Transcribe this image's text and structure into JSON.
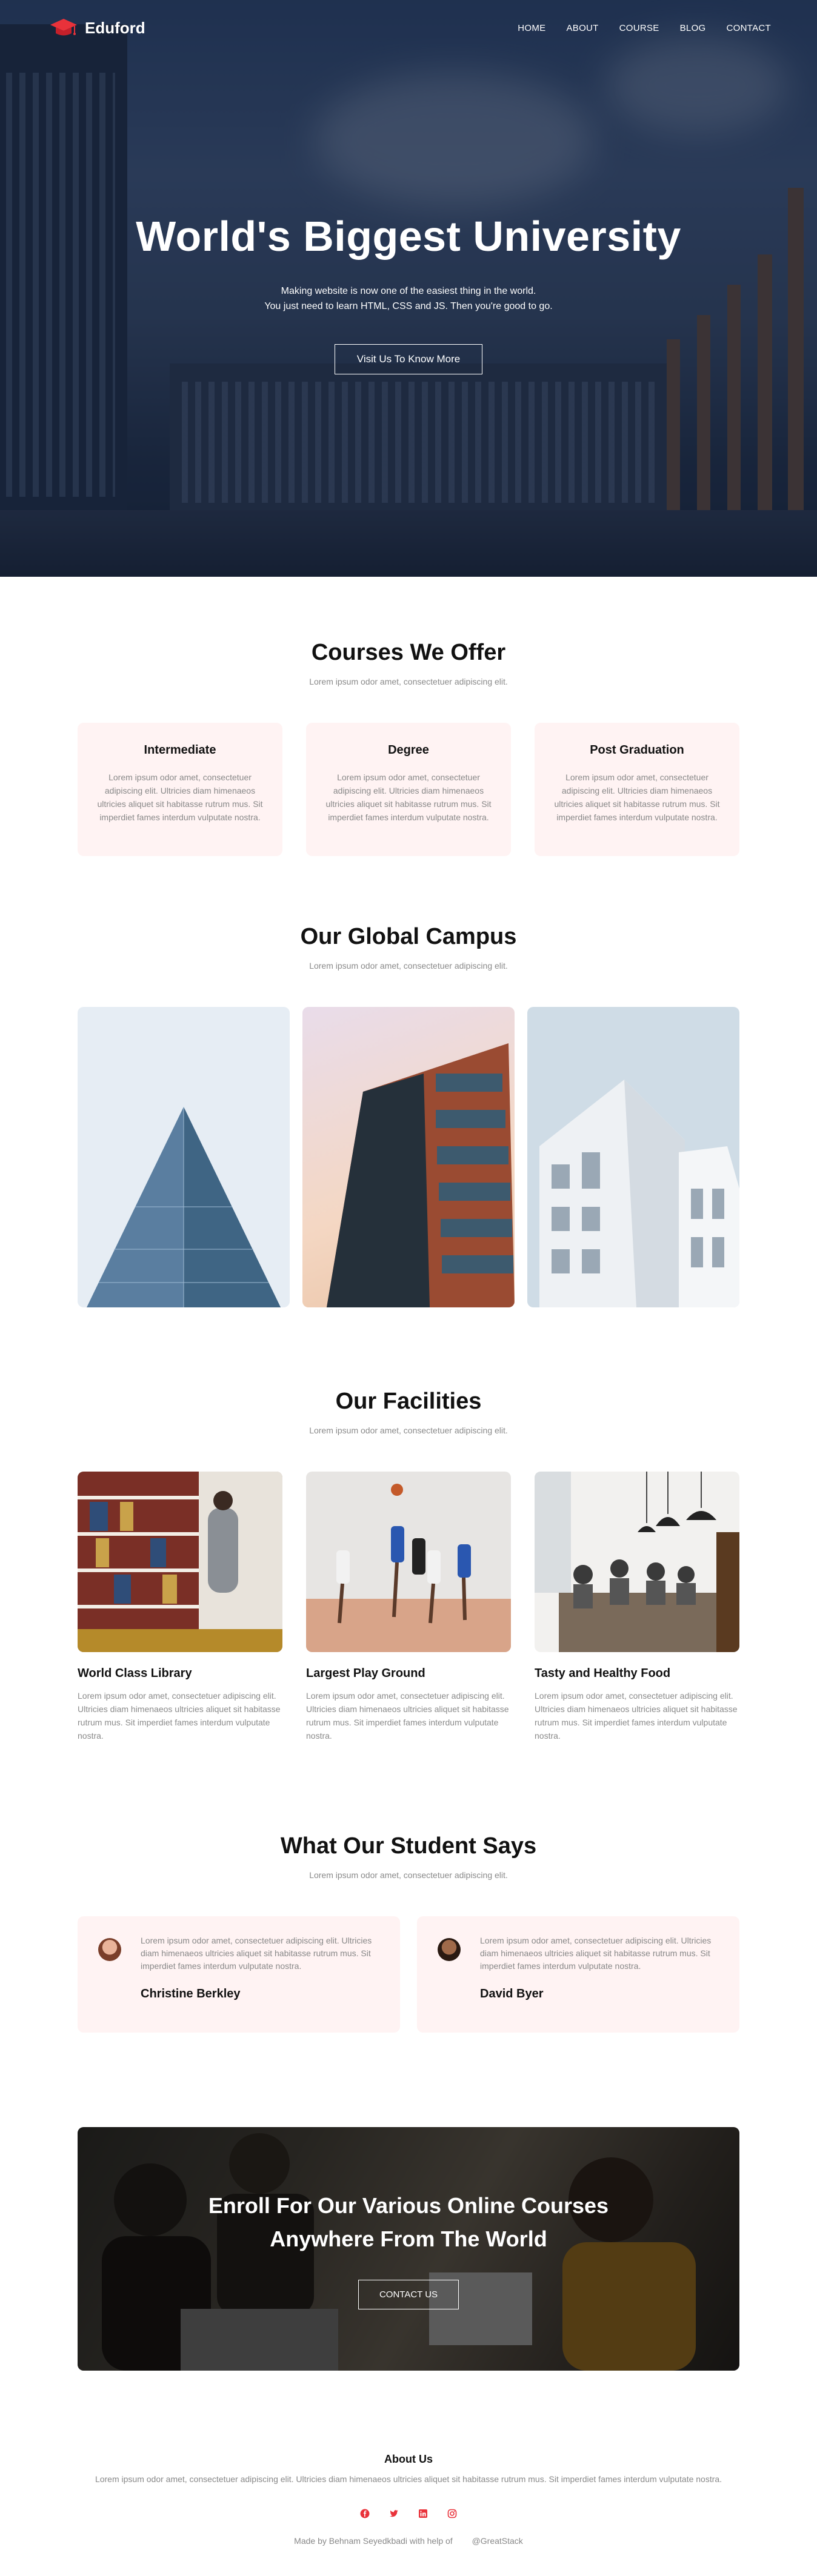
{
  "brand": {
    "name": "Eduford",
    "accent": "#e9323a"
  },
  "nav": {
    "links": [
      "HOME",
      "ABOUT",
      "COURSE",
      "BLOG",
      "CONTACT"
    ]
  },
  "hero": {
    "title": "World's Biggest University",
    "subtitle_line1": "Making website is now one of the easiest thing in the world.",
    "subtitle_line2": "You just need to learn HTML, CSS and JS. Then you're good to go.",
    "button": "Visit Us To Know More"
  },
  "courses": {
    "title": "Courses We Offer",
    "subtitle": "Lorem ipsum odor amet, consectetuer adipiscing elit.",
    "items": [
      {
        "title": "Intermediate",
        "text": "Lorem ipsum odor amet, consectetuer adipiscing elit. Ultricies diam himenaeos ultricies aliquet sit habitasse rutrum mus. Sit imperdiet fames interdum vulputate nostra."
      },
      {
        "title": "Degree",
        "text": "Lorem ipsum odor amet, consectetuer adipiscing elit. Ultricies diam himenaeos ultricies aliquet sit habitasse rutrum mus. Sit imperdiet fames interdum vulputate nostra."
      },
      {
        "title": "Post Graduation",
        "text": "Lorem ipsum odor amet, consectetuer adipiscing elit. Ultricies diam himenaeos ultricies aliquet sit habitasse rutrum mus. Sit imperdiet fames interdum vulputate nostra."
      }
    ]
  },
  "campus": {
    "title": "Our Global Campus",
    "subtitle": "Lorem ipsum odor amet, consectetuer adipiscing elit."
  },
  "facilities": {
    "title": "Our Facilities",
    "subtitle": "Lorem ipsum odor amet, consectetuer adipiscing elit.",
    "items": [
      {
        "title": "World Class Library",
        "text": "Lorem ipsum odor amet, consectetuer adipiscing elit. Ultricies diam himenaeos ultricies aliquet sit habitasse rutrum mus. Sit imperdiet fames interdum vulputate nostra."
      },
      {
        "title": "Largest Play Ground",
        "text": "Lorem ipsum odor amet, consectetuer adipiscing elit. Ultricies diam himenaeos ultricies aliquet sit habitasse rutrum mus. Sit imperdiet fames interdum vulputate nostra."
      },
      {
        "title": "Tasty and Healthy Food",
        "text": "Lorem ipsum odor amet, consectetuer adipiscing elit. Ultricies diam himenaeos ultricies aliquet sit habitasse rutrum mus. Sit imperdiet fames interdum vulputate nostra."
      }
    ]
  },
  "testimonials": {
    "title": "What Our Student Says",
    "subtitle": "Lorem ipsum odor amet, consectetuer adipiscing elit.",
    "items": [
      {
        "name": "Christine Berkley",
        "text": "Lorem ipsum odor amet, consectetuer adipiscing elit. Ultricies diam himenaeos ultricies aliquet sit habitasse rutrum mus. Sit imperdiet fames interdum vulputate nostra."
      },
      {
        "name": "David Byer",
        "text": "Lorem ipsum odor amet, consectetuer adipiscing elit. Ultricies diam himenaeos ultricies aliquet sit habitasse rutrum mus. Sit imperdiet fames interdum vulputate nostra."
      }
    ]
  },
  "cta": {
    "title_line1": "Enroll For Our Various Online Courses",
    "title_line2": "Anywhere From The World",
    "button": "CONTACT US"
  },
  "footer": {
    "title": "About Us",
    "text": "Lorem ipsum odor amet, consectetuer adipiscing elit. Ultricies diam himenaeos ultricies aliquet sit habitasse rutrum mus. Sit imperdiet fames interdum vulputate nostra.",
    "socials": [
      "facebook-icon",
      "twitter-icon",
      "linkedin-icon",
      "instagram-icon"
    ],
    "credit": "Made by Behnam Seyedkbadi with help of",
    "credit_link": "@GreatStack"
  }
}
